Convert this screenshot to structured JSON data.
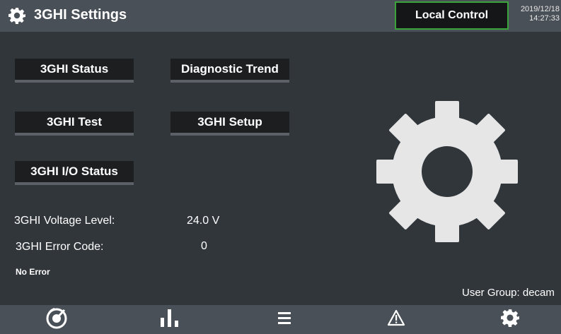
{
  "header": {
    "title": "3GHI Settings",
    "title_icon": "gear-icon",
    "control_mode": "Local Control",
    "date": "2019/12/18",
    "time": "14:27:33"
  },
  "menu": {
    "status": "3GHI Status",
    "trend": "Diagnostic Trend",
    "test": "3GHI Test",
    "setup": "3GHI Setup",
    "io_status": "3GHI I/O Status"
  },
  "info": {
    "voltage_label": "3GHI Voltage Level:",
    "voltage_value": "24.0 V",
    "error_label": "3GHI Error Code:",
    "error_value": "0",
    "error_text": "No Error",
    "user_group": "User Group: decam"
  },
  "nav": {
    "items": [
      "gauge-icon",
      "bar-chart-icon",
      "menu-icon",
      "warning-icon",
      "settings-icon"
    ]
  },
  "colors": {
    "background": "#31363b",
    "bar": "#4a5057",
    "button": "#1c1e20",
    "active_border": "#3aa43a"
  }
}
